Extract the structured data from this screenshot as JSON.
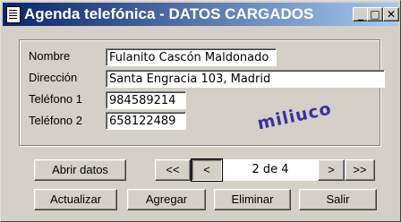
{
  "window": {
    "title": "Agenda telefónica - DATOS CARGADOS"
  },
  "captions": {
    "minimize": "_",
    "maximize": "□",
    "close": "✕"
  },
  "form": {
    "nombre_label": "Nombre",
    "nombre_value": "Fulanito Cascón Maldonado",
    "direccion_label": "Dirección",
    "direccion_value": "Santa Engracia 103, Madrid",
    "telefono1_label": "Teléfono 1",
    "telefono1_value": "984589214",
    "telefono2_label": "Teléfono 2",
    "telefono2_value": "658122489"
  },
  "logo": "miliuco",
  "buttons": {
    "abrir": "Abrir datos",
    "first": "<<",
    "prev": "<",
    "next": ">",
    "last": ">>",
    "actualizar": "Actualizar",
    "agregar": "Agregar",
    "eliminar": "Eliminar",
    "salir": "Salir"
  },
  "nav": {
    "record_label": "2 de 4"
  }
}
